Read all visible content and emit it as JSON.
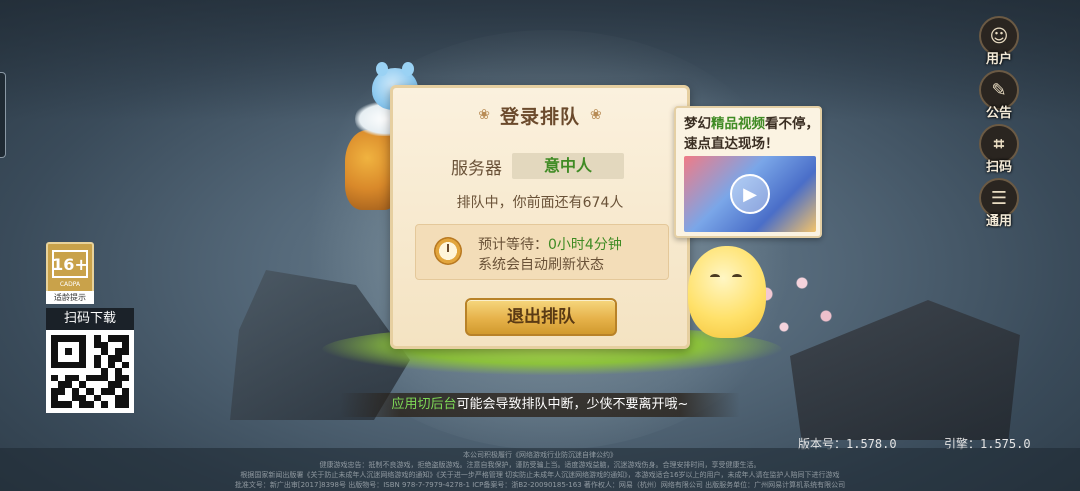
{
  "side_menu": [
    {
      "id": "user",
      "label": "用户",
      "icon": "user-icon",
      "glyph": "☺"
    },
    {
      "id": "notice",
      "label": "公告",
      "icon": "notice-icon",
      "glyph": "✎"
    },
    {
      "id": "scan",
      "label": "扫码",
      "icon": "scan-icon",
      "glyph": "⌗"
    },
    {
      "id": "general",
      "label": "通用",
      "icon": "general-icon",
      "glyph": "☰"
    }
  ],
  "age_rating": {
    "value": "16+",
    "org": "CADPA",
    "tip": "适龄提示"
  },
  "qr_download": {
    "title": "扫码下载"
  },
  "dialog": {
    "title": "登录排队",
    "server_label": "服务器",
    "server_name": "意中人",
    "queue_prefix": "排队中，你前面还有",
    "queue_count": "674",
    "queue_suffix": "人",
    "wait_label": "预计等待：",
    "wait_value": "0小时4分钟",
    "auto_refresh": "系统会自动刷新状态",
    "exit_button": "退出排队"
  },
  "promo": {
    "text_before": "梦幻",
    "text_highlight": "精品视频",
    "text_after": "看不停，速点直达现场！"
  },
  "warning": {
    "highlight": "应用切后台",
    "text": "可能会导致排队中断，少侠不要离开哦~"
  },
  "version": {
    "app": "版本号：1.578.0",
    "engine": "引擎：1.575.0"
  },
  "legal_lines": [
    "本公司积极履行《网络游戏行业防沉迷自律公约》",
    "健康游戏忠告：抵制不良游戏，拒绝盗版游戏。注意自我保护，谨防受骗上当。适度游戏益脑，沉迷游戏伤身。合理安排时间，享受健康生活。",
    "根据国家新闻出版署《关于防止未成年人沉迷网络游戏的通知》《关于进一步严格管理 切实防止未成年人沉迷网络游戏的通知》，本游戏适合16岁以上的用户，未成年人请在监护人陪同下进行游戏",
    "批准文号：新广出审[2017]8398号  出版物号：ISBN 978-7-7979-4278-1  ICP备案号：浙B2-20090185-163  著作权人：网易（杭州）网络有限公司  出版服务单位：广州网易计算机系统有限公司"
  ],
  "colors": {
    "accent_green": "#3f8b24",
    "dialog_bg": "#fbf1de",
    "button_gold": "#e6b24a"
  }
}
